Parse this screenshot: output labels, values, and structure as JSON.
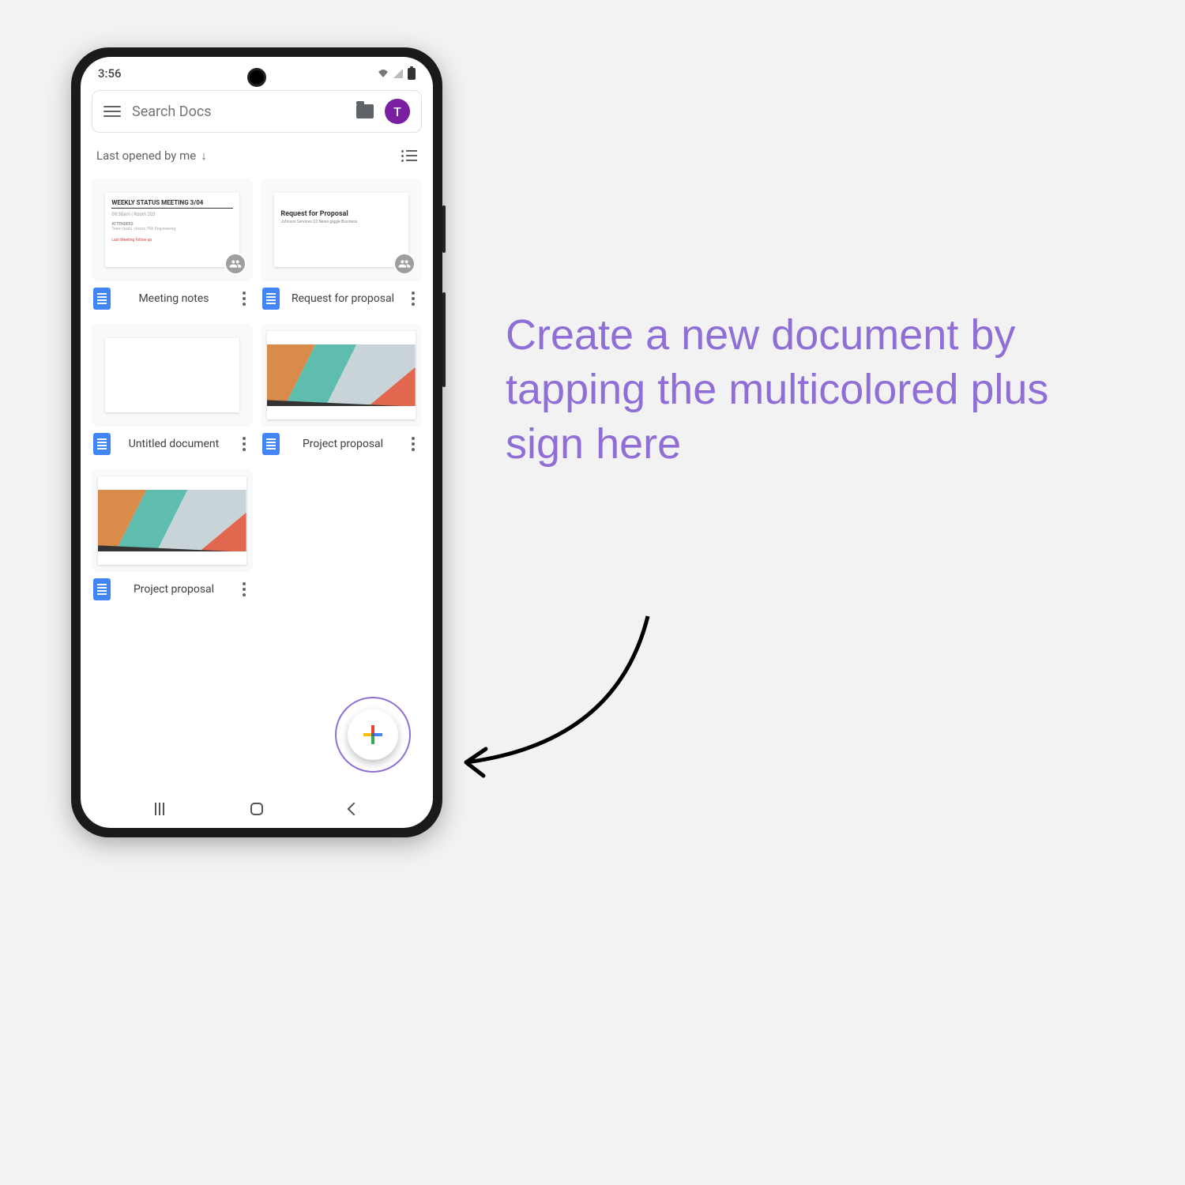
{
  "status": {
    "time": "3:56"
  },
  "search": {
    "placeholder": "Search Docs",
    "avatar_initial": "T"
  },
  "sort": {
    "label": "Last opened by me"
  },
  "docs": [
    {
      "title": "Meeting notes",
      "shared": true,
      "preview_title": "WEEKLY STATUS MEETING 3/04"
    },
    {
      "title": "Request for proposal",
      "shared": true,
      "preview_title": "Request for Proposal",
      "preview_sub": "Johnson Services Q2 News giggle Business"
    },
    {
      "title": "Untitled document",
      "shared": false
    },
    {
      "title": "Project proposal",
      "shared": false
    },
    {
      "title": "Project proposal",
      "shared": false
    }
  ],
  "callout": "Create a new document by tapping the multicolored plus sign here"
}
